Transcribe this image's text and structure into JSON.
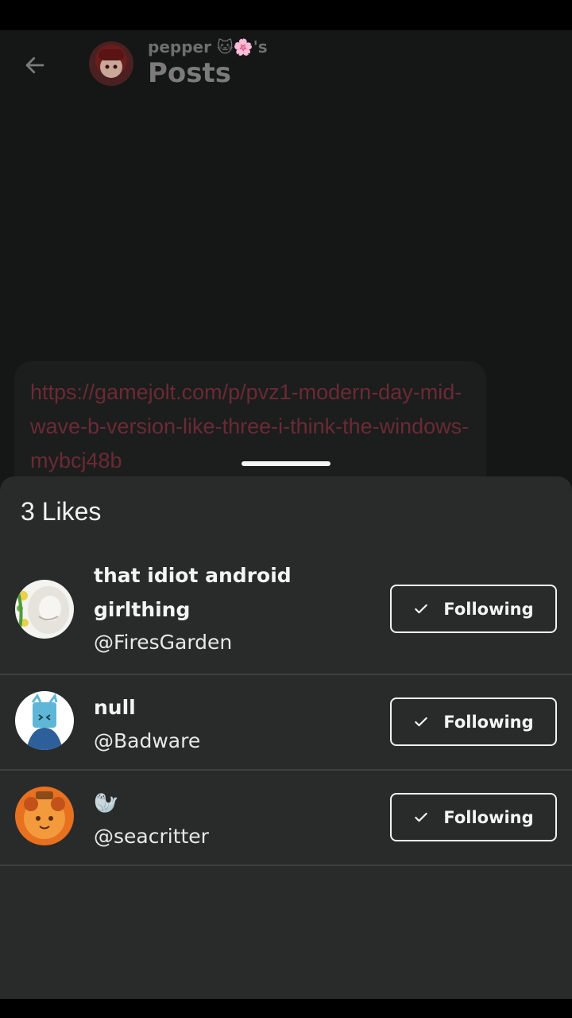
{
  "header": {
    "subtitle": "pepper 🐱🌸's",
    "title": "Posts"
  },
  "post": {
    "link": "https://gamejolt.com/p/pvz1-modern-day-mid-wave-b-version-like-three-i-think-the-windows-mybcj48b"
  },
  "likes_sheet": {
    "title": "3 Likes",
    "users": [
      {
        "name": "that idiot android girlthing",
        "handle": "@FiresGarden",
        "button": "Following"
      },
      {
        "name": "null",
        "handle": "@Badware",
        "button": "Following"
      },
      {
        "name": "🦭",
        "handle": "@seacritter",
        "button": "Following"
      }
    ]
  },
  "icons": {
    "back": "arrow-left-icon",
    "check": "check-icon"
  }
}
